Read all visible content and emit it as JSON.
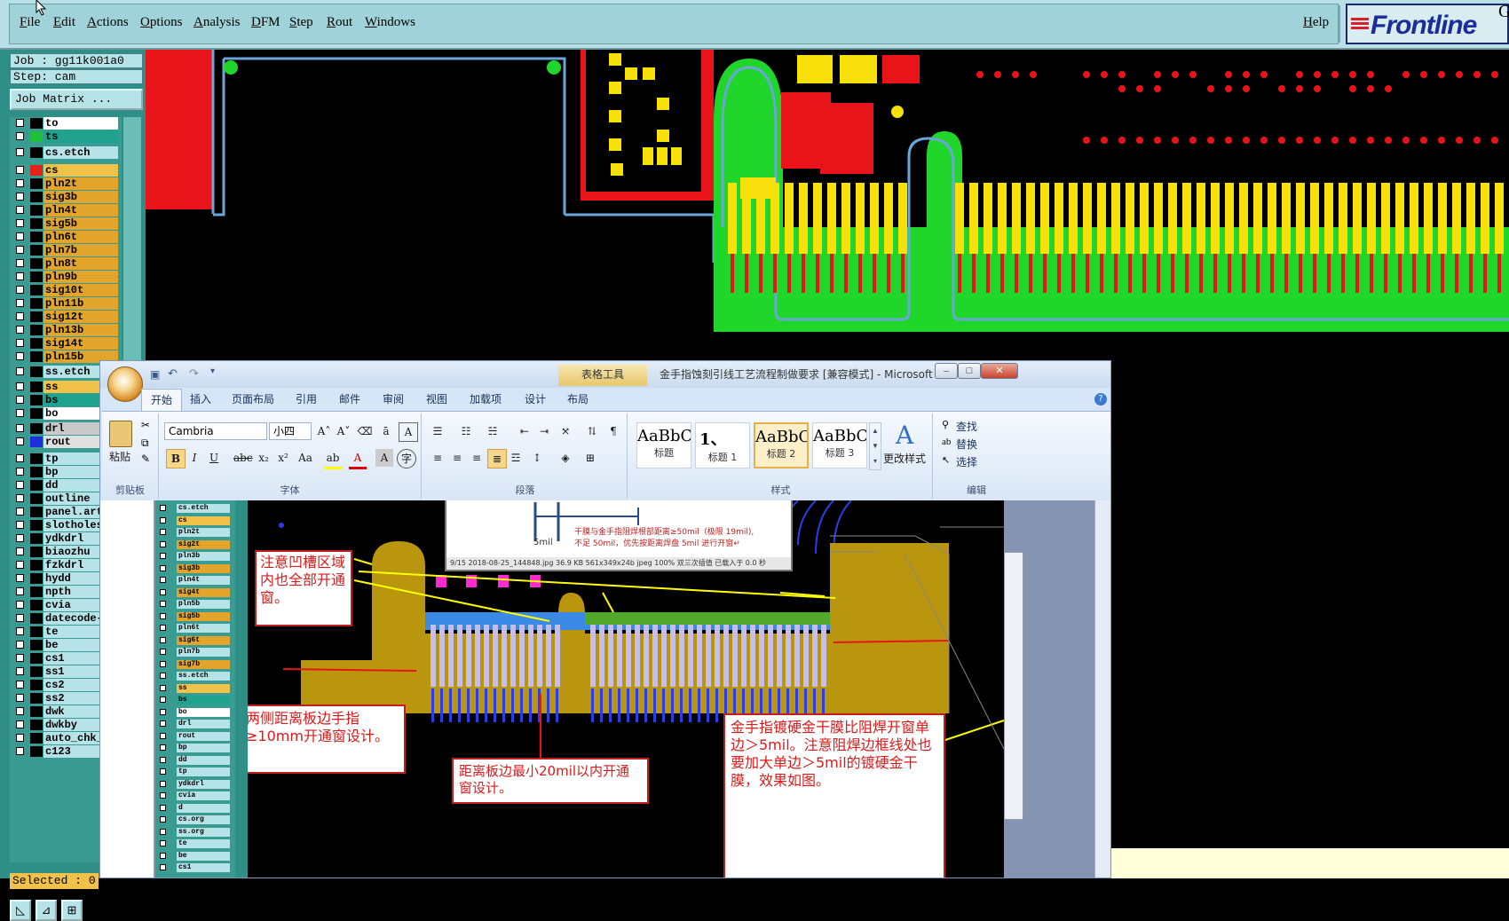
{
  "menubar": {
    "items": [
      "File",
      "Edit",
      "Actions",
      "Options",
      "Analysis",
      "DFM",
      "Step",
      "Rout",
      "Windows"
    ],
    "help": "Help",
    "logo": "Frontline",
    "logo_extra": "G"
  },
  "job": {
    "job_label": "Job : gg11k001a0",
    "step_label": "Step: cam",
    "matrix_button": "Job Matrix ..."
  },
  "layers": [
    {
      "name": "to",
      "swatch": "#000000",
      "bg": "#ffffff"
    },
    {
      "name": "ts",
      "swatch": "#1fbf3a",
      "bg": "#1fa38e"
    },
    {
      "name": "cs.etch",
      "swatch": "#000000",
      "bg": "#b6e3e7"
    },
    {
      "name": "cs",
      "swatch": "#e2231a",
      "bg": "#f1c24a"
    },
    {
      "name": "pln2t",
      "swatch": "#000000",
      "bg": "#e2a42a"
    },
    {
      "name": "sig3b",
      "swatch": "#000000",
      "bg": "#e2a42a"
    },
    {
      "name": "pln4t",
      "swatch": "#000000",
      "bg": "#e2a42a"
    },
    {
      "name": "sig5b",
      "swatch": "#000000",
      "bg": "#e2a42a"
    },
    {
      "name": "pln6t",
      "swatch": "#000000",
      "bg": "#e2a42a"
    },
    {
      "name": "pln7b",
      "swatch": "#000000",
      "bg": "#e2a42a"
    },
    {
      "name": "pln8t",
      "swatch": "#000000",
      "bg": "#e2a42a"
    },
    {
      "name": "pln9b",
      "swatch": "#000000",
      "bg": "#e2a42a"
    },
    {
      "name": "sig10t",
      "swatch": "#000000",
      "bg": "#e2a42a"
    },
    {
      "name": "pln11b",
      "swatch": "#000000",
      "bg": "#e2a42a"
    },
    {
      "name": "sig12t",
      "swatch": "#000000",
      "bg": "#e2a42a"
    },
    {
      "name": "pln13b",
      "swatch": "#000000",
      "bg": "#e2a42a"
    },
    {
      "name": "sig14t",
      "swatch": "#000000",
      "bg": "#e2a42a"
    },
    {
      "name": "pln15b",
      "swatch": "#000000",
      "bg": "#e2a42a"
    },
    {
      "name": "ss.etch",
      "swatch": "#000000",
      "bg": "#b6e3e7"
    },
    {
      "name": "ss",
      "swatch": "#000000",
      "bg": "#f1c24a"
    },
    {
      "name": "bs",
      "swatch": "#000000",
      "bg": "#1fa38e"
    },
    {
      "name": "bo",
      "swatch": "#000000",
      "bg": "#ffffff"
    },
    {
      "name": "drl",
      "swatch": "#000000",
      "bg": "#c9c9c9"
    },
    {
      "name": "rout",
      "swatch": "#1f2fe0",
      "bg": "#e0e0e0"
    },
    {
      "name": "tp",
      "swatch": "#000000",
      "bg": "#b6e3e7"
    },
    {
      "name": "bp",
      "swatch": "#000000",
      "bg": "#b6e3e7"
    },
    {
      "name": "dd",
      "swatch": "#000000",
      "bg": "#b6e3e7"
    },
    {
      "name": "outline",
      "swatch": "#000000",
      "bg": "#b6e3e7"
    },
    {
      "name": "panel.art",
      "swatch": "#000000",
      "bg": "#b6e3e7"
    },
    {
      "name": "slotholes",
      "swatch": "#000000",
      "bg": "#b6e3e7"
    },
    {
      "name": "ydkdrl",
      "swatch": "#000000",
      "bg": "#b6e3e7"
    },
    {
      "name": "biaozhu",
      "swatch": "#000000",
      "bg": "#b6e3e7"
    },
    {
      "name": "fzkdrl",
      "swatch": "#000000",
      "bg": "#b6e3e7"
    },
    {
      "name": "hydd",
      "swatch": "#000000",
      "bg": "#b6e3e7"
    },
    {
      "name": "npth",
      "swatch": "#000000",
      "bg": "#b6e3e7"
    },
    {
      "name": "cvia",
      "swatch": "#000000",
      "bg": "#b6e3e7"
    },
    {
      "name": "datecode-",
      "swatch": "#000000",
      "bg": "#b6e3e7"
    },
    {
      "name": "te",
      "swatch": "#000000",
      "bg": "#b6e3e7"
    },
    {
      "name": "be",
      "swatch": "#000000",
      "bg": "#b6e3e7"
    },
    {
      "name": "cs1",
      "swatch": "#000000",
      "bg": "#b6e3e7"
    },
    {
      "name": "ss1",
      "swatch": "#000000",
      "bg": "#b6e3e7"
    },
    {
      "name": "cs2",
      "swatch": "#000000",
      "bg": "#b6e3e7"
    },
    {
      "name": "ss2",
      "swatch": "#000000",
      "bg": "#b6e3e7"
    },
    {
      "name": "dwk",
      "swatch": "#000000",
      "bg": "#b6e3e7"
    },
    {
      "name": "dwkby",
      "swatch": "#000000",
      "bg": "#b6e3e7"
    },
    {
      "name": "auto_chk_",
      "swatch": "#000000",
      "bg": "#b6e3e7"
    },
    {
      "name": "c123",
      "swatch": "#000000",
      "bg": "#b6e3e7"
    }
  ],
  "selected_label": "Selected : 0",
  "word": {
    "context_tab": "表格工具",
    "title": "金手指蚀刻引线工艺流程制做要求 [兼容模式] - Microsoft Word",
    "tabs": [
      "开始",
      "插入",
      "页面布局",
      "引用",
      "邮件",
      "审阅",
      "视图",
      "加载项",
      "设计",
      "布局"
    ],
    "clipboard": {
      "paste": "粘贴",
      "group": "剪贴板"
    },
    "font": {
      "name": "Cambria",
      "size": "小四",
      "group": "字体"
    },
    "paragraph_group": "段落",
    "styles": {
      "cards": [
        {
          "sample": "AaBbC(",
          "name": "标题"
        },
        {
          "sample": "1、",
          "name": "标题 1"
        },
        {
          "sample": "AaBbC(",
          "name": "标题 2"
        },
        {
          "sample": "AaBbC(",
          "name": "标题 3"
        }
      ],
      "change": "更改样式",
      "group": "样式"
    },
    "editing": {
      "find": "查找",
      "replace": "替换",
      "select": "选择",
      "group": "编辑"
    }
  },
  "embedded": {
    "layers": [
      "cs.etch",
      "cs",
      "pln2t",
      "sig2t",
      "pln3b",
      "sig3b",
      "pln4t",
      "sig4t",
      "pln5b",
      "sig5b",
      "pln6t",
      "sig6t",
      "pln7b",
      "sig7b",
      "ss.etch",
      "ss",
      "bs",
      "bo",
      "drl",
      "rout",
      "bp",
      "dd",
      "tp",
      "ydkdrl",
      "cvia",
      "d",
      "cs.org",
      "ss.org",
      "te",
      "be",
      "cs1"
    ],
    "popup_text_1": "干膜与金手指阻焊根部距离≥50mil（极限 19mil),",
    "popup_text_2": "不足 50mil，优先按距离焊盘 5mil 进行开窗↵",
    "popup_dim": "5mil",
    "popup_status": "9/15  2018-08-25_144848.jpg  36.9 KB  561x349x24b jpeg  100%  双三次插值  已载入于 0.0 秒",
    "note1": "注意凹槽区域内也全部开通窗。",
    "note2": "两侧距离板边手指≥10mm开通窗设计。",
    "note3": "距离板边最小20mil以内开通窗设计。",
    "note4": "金手指镀硬金干膜比阻焊开窗单边＞5mil。注意阻焊边框线处也要加大单边＞5mil的镀硬金干膜，效果如图。"
  }
}
